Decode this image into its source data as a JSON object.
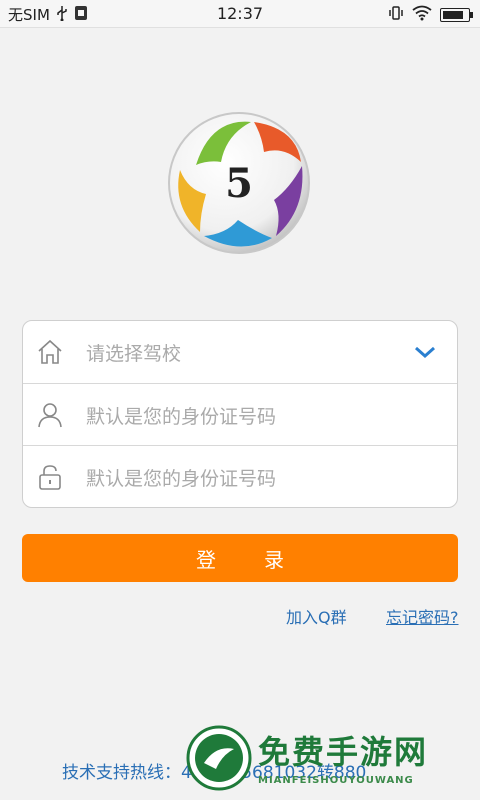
{
  "status_bar": {
    "carrier": "无SIM",
    "time": "12:37",
    "battery_level": 0.85
  },
  "logo": {
    "number": "5"
  },
  "form": {
    "school_placeholder": "请选择驾校",
    "id_placeholder": "默认是您的身份证号码",
    "password_placeholder": "默认是您的身份证号码"
  },
  "login_button": {
    "left": "登",
    "right": "录"
  },
  "links": {
    "join_qq": "加入Q群",
    "forgot_password": "忘记密码?"
  },
  "footer": {
    "hotline": "技术支持热线：4001-65681032转880"
  },
  "watermark": {
    "title": "免费手游网",
    "subtitle": "MIANFEISHOUYOUWANG"
  },
  "colors": {
    "accent": "#ff8000",
    "link": "#2a6fb5"
  }
}
